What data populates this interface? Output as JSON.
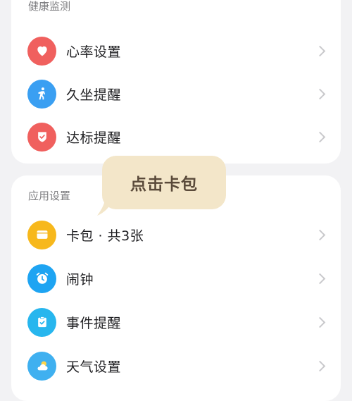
{
  "health": {
    "title": "健康监测",
    "items": [
      {
        "label": "心率设置",
        "icon": "heart-icon",
        "color": "#f0605e"
      },
      {
        "label": "久坐提醒",
        "icon": "person-walking-icon",
        "color": "#3a9ff2"
      },
      {
        "label": "达标提醒",
        "icon": "shield-check-icon",
        "color": "#f0605e"
      }
    ]
  },
  "apps": {
    "title": "应用设置",
    "items": [
      {
        "label": "卡包 · 共3张",
        "icon": "wallet-card-icon",
        "color": "#f7b81c"
      },
      {
        "label": "闹钟",
        "icon": "alarm-clock-icon",
        "color": "#1ea4f2"
      },
      {
        "label": "事件提醒",
        "icon": "clipboard-check-icon",
        "color": "#27b6ee"
      },
      {
        "label": "天气设置",
        "icon": "weather-icon",
        "color": "#3fb0f0"
      }
    ]
  },
  "tooltip": {
    "text": "点击卡包",
    "color": "#f3e6c9"
  }
}
